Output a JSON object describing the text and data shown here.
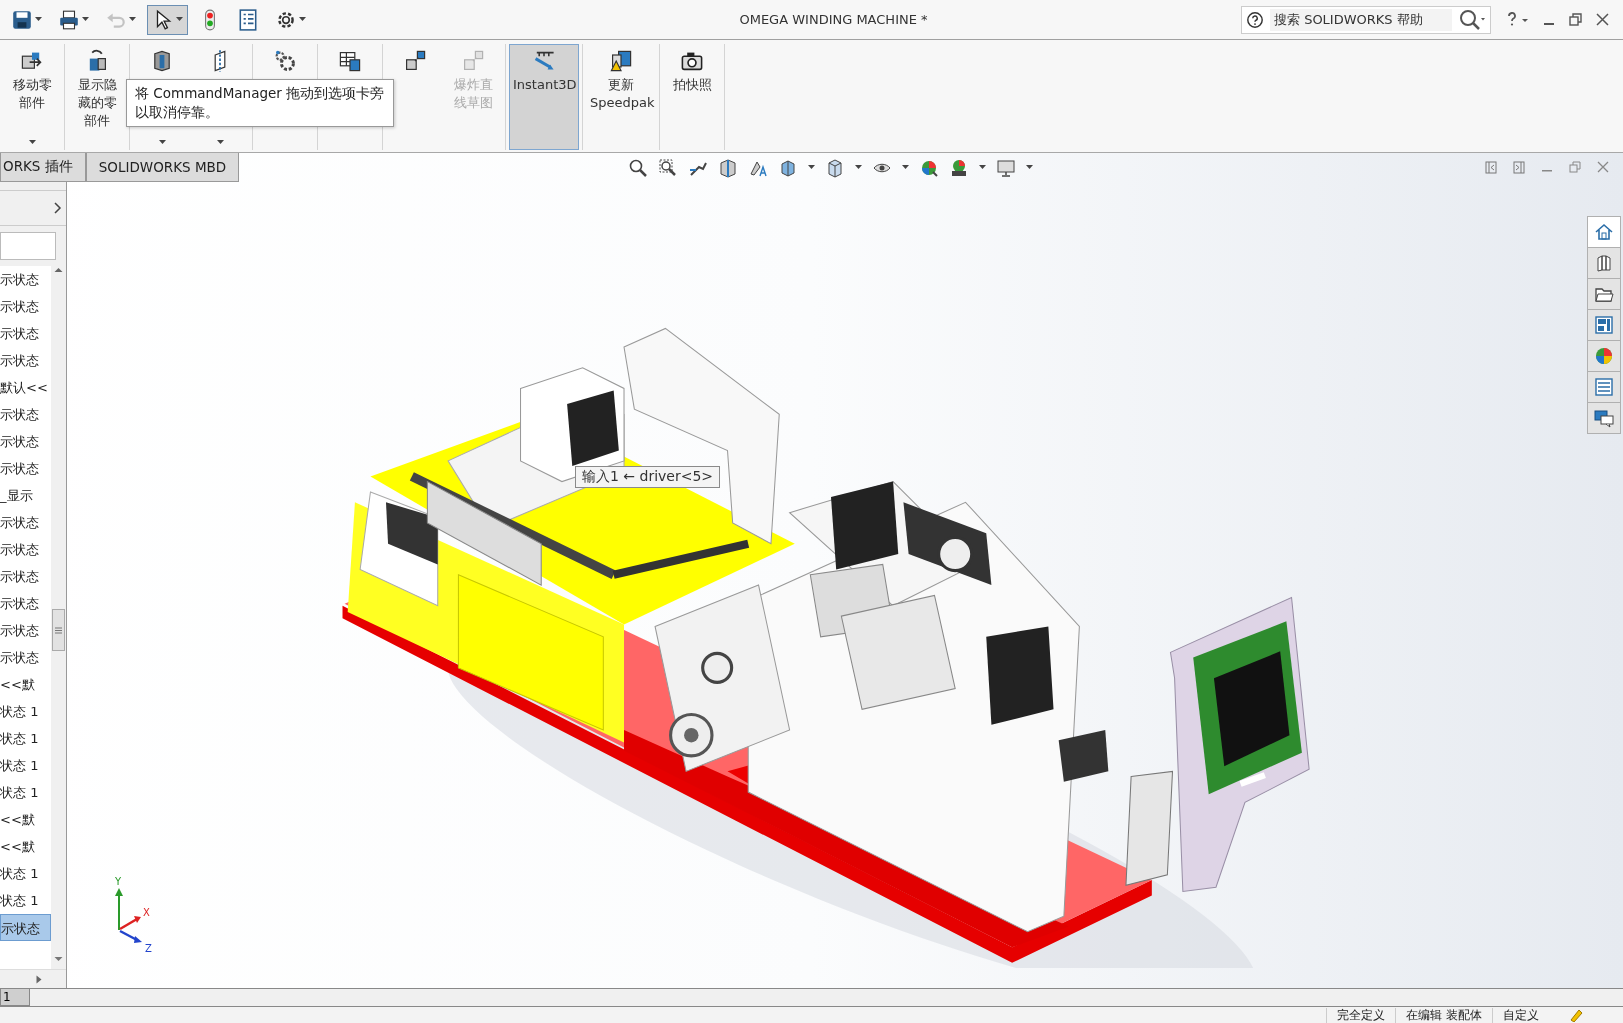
{
  "window": {
    "title": "OMEGA WINDING MACHINE *"
  },
  "quick_tools": [
    {
      "kind": "save",
      "selected": false,
      "disabled": false
    },
    {
      "kind": "print",
      "selected": false,
      "disabled": false
    },
    {
      "kind": "undo",
      "selected": false,
      "disabled": true
    },
    {
      "kind": "select",
      "selected": true,
      "disabled": false
    },
    {
      "kind": "rebuild",
      "selected": false,
      "disabled": false
    },
    {
      "kind": "properties",
      "selected": false,
      "disabled": false
    },
    {
      "kind": "options",
      "selected": false,
      "disabled": false
    }
  ],
  "help_search": {
    "placeholder": "搜索 SOLIDWORKS 帮助"
  },
  "command_manager": {
    "groups": [
      {
        "buttons": [
          {
            "kind": "move",
            "label": "移动零部件",
            "dropdown": true,
            "selected": false,
            "disabled": false
          }
        ]
      },
      {
        "buttons": [
          {
            "kind": "show_hidden",
            "label": "显示隐藏的零部件",
            "dropdown": false,
            "selected": false,
            "disabled": false
          }
        ]
      },
      {
        "buttons": [
          {
            "kind": "assembly",
            "dropdown": true,
            "selected": false,
            "disabled": false
          },
          {
            "kind": "reference",
            "dropdown": true,
            "selected": false,
            "disabled": false
          }
        ]
      },
      {
        "buttons": [
          {
            "kind": "gear",
            "dropdown": false,
            "selected": false,
            "disabled": false
          }
        ]
      },
      {
        "buttons": [
          {
            "kind": "table",
            "dropdown": false,
            "selected": false,
            "disabled": false
          }
        ]
      },
      {
        "buttons": [
          {
            "kind": "explode",
            "dropdown": false,
            "selected": false,
            "disabled": false
          },
          {
            "kind": "explode_sketch",
            "label": "爆炸直线草图",
            "dropdown": false,
            "selected": false,
            "disabled": true
          }
        ]
      },
      {
        "buttons": [
          {
            "kind": "instant3d",
            "label": "Instant3D",
            "dropdown": false,
            "selected": true,
            "disabled": false
          }
        ]
      },
      {
        "buttons": [
          {
            "kind": "speedpak",
            "label": "更新 Speedpak",
            "dropdown": false,
            "selected": false,
            "disabled": false
          }
        ]
      },
      {
        "buttons": [
          {
            "kind": "snapshot",
            "label": "拍快照",
            "dropdown": false,
            "selected": false,
            "disabled": false
          }
        ]
      }
    ]
  },
  "tooltip": {
    "text": "将 CommandManager 拖动到选项卡旁以取消停靠。"
  },
  "tabs": [
    {
      "label": "ORKS 插件",
      "selected": false
    },
    {
      "label": "SOLIDWORKS MBD",
      "selected": false
    }
  ],
  "tree": {
    "items": [
      {
        "label": "示状态",
        "selected": false
      },
      {
        "label": "示状态",
        "selected": false
      },
      {
        "label": "示状态",
        "selected": false
      },
      {
        "label": "示状态",
        "selected": false
      },
      {
        "label": "默认<<",
        "selected": false
      },
      {
        "label": "示状态",
        "selected": false
      },
      {
        "label": "示状态",
        "selected": false
      },
      {
        "label": "示状态",
        "selected": false
      },
      {
        "label": "_显示",
        "selected": false
      },
      {
        "label": "示状态",
        "selected": false
      },
      {
        "label": "示状态",
        "selected": false
      },
      {
        "label": "示状态",
        "selected": false
      },
      {
        "label": "示状态",
        "selected": false
      },
      {
        "label": "示状态",
        "selected": false
      },
      {
        "label": "示状态",
        "selected": false
      },
      {
        "label": "<<默",
        "selected": false
      },
      {
        "label": "状态 1",
        "selected": false
      },
      {
        "label": "状态 1",
        "selected": false
      },
      {
        "label": "状态 1",
        "selected": false
      },
      {
        "label": "状态 1",
        "selected": false
      },
      {
        "label": "<<默",
        "selected": false
      },
      {
        "label": "<<默",
        "selected": false
      },
      {
        "label": "状态 1",
        "selected": false
      },
      {
        "label": "状态 1",
        "selected": false
      },
      {
        "label": "示状态",
        "selected": true
      }
    ]
  },
  "viewport": {
    "callout": "输入1 ← driver<5>",
    "triad": {
      "x": "X",
      "y": "Y",
      "z": "Z"
    }
  },
  "bottom_tabs": [
    {
      "label": "1",
      "selected": true
    }
  ],
  "status_bar": {
    "items": [
      "完全定义",
      "在编辑 装配体",
      "自定义"
    ]
  }
}
